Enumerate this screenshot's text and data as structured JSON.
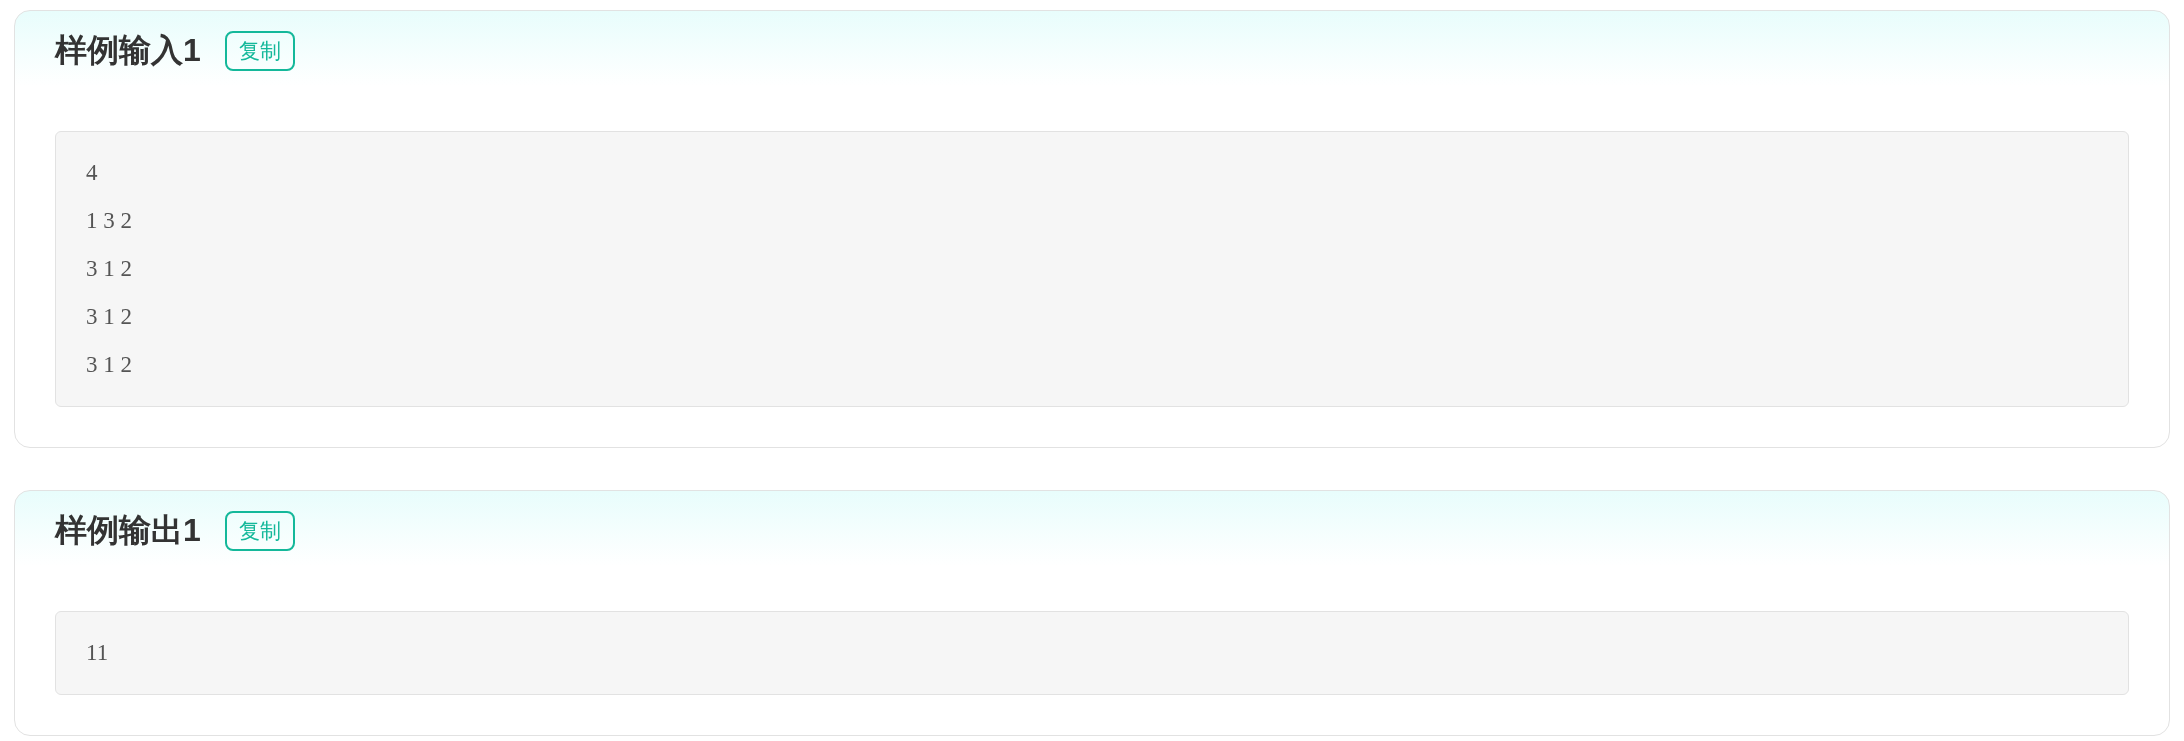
{
  "samples": [
    {
      "title": "样例输入1",
      "copy_button": "复制",
      "lines": [
        "4",
        "1 3 2",
        "3 1 2",
        "3 1 2",
        "3 1 2"
      ]
    },
    {
      "title": "样例输出1",
      "copy_button": "复制",
      "lines": [
        "11"
      ]
    }
  ]
}
